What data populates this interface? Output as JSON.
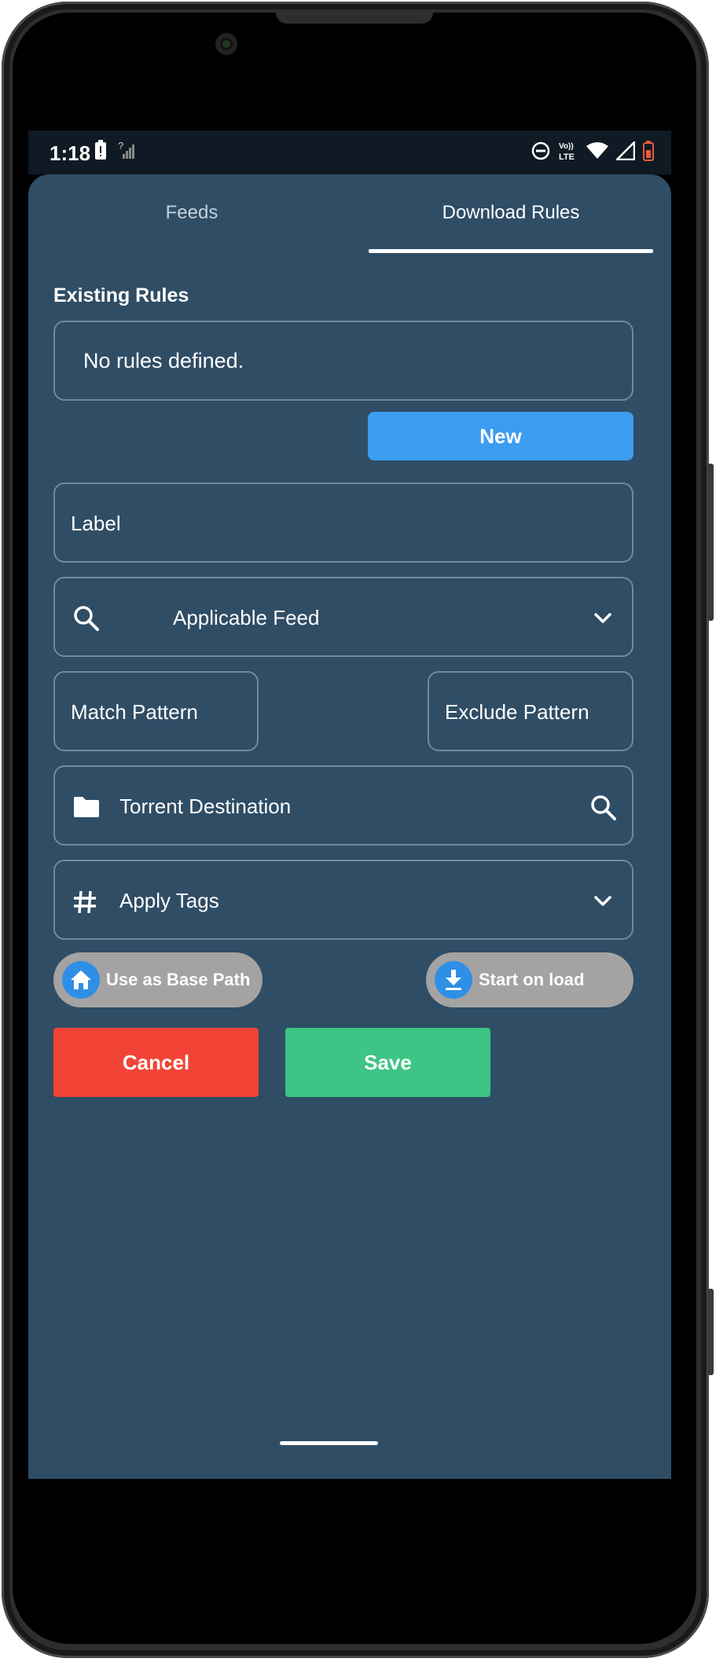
{
  "status_bar": {
    "time": "1:18",
    "icons_left": [
      "battery-alert-icon",
      "no-signal-icon"
    ],
    "icons_right": [
      "do-not-disturb-icon",
      "volte-icon",
      "wifi-icon",
      "cell-signal-icon",
      "battery-low-icon"
    ],
    "volte_label": "Vo)) LTE"
  },
  "tabs": [
    {
      "label": "Feeds",
      "active": false
    },
    {
      "label": "Download Rules",
      "active": true
    }
  ],
  "existing_rules": {
    "title": "Existing Rules",
    "empty_text": "No rules defined."
  },
  "new_button": "New",
  "form": {
    "label_field": "Label",
    "applicable_feed": "Applicable Feed",
    "match_pattern": "Match Pattern",
    "exclude_pattern": "Exclude Pattern",
    "torrent_destination": "Torrent Destination",
    "apply_tags": "Apply Tags"
  },
  "chips": {
    "base_path": "Use as Base Path",
    "start_on_load": "Start on load"
  },
  "actions": {
    "cancel": "Cancel",
    "save": "Save"
  },
  "colors": {
    "app_background": "#2f4d65",
    "primary": "#3c9cf0",
    "cancel": "#f24436",
    "save": "#3cc584",
    "chip_background": "#a3a3a3"
  }
}
